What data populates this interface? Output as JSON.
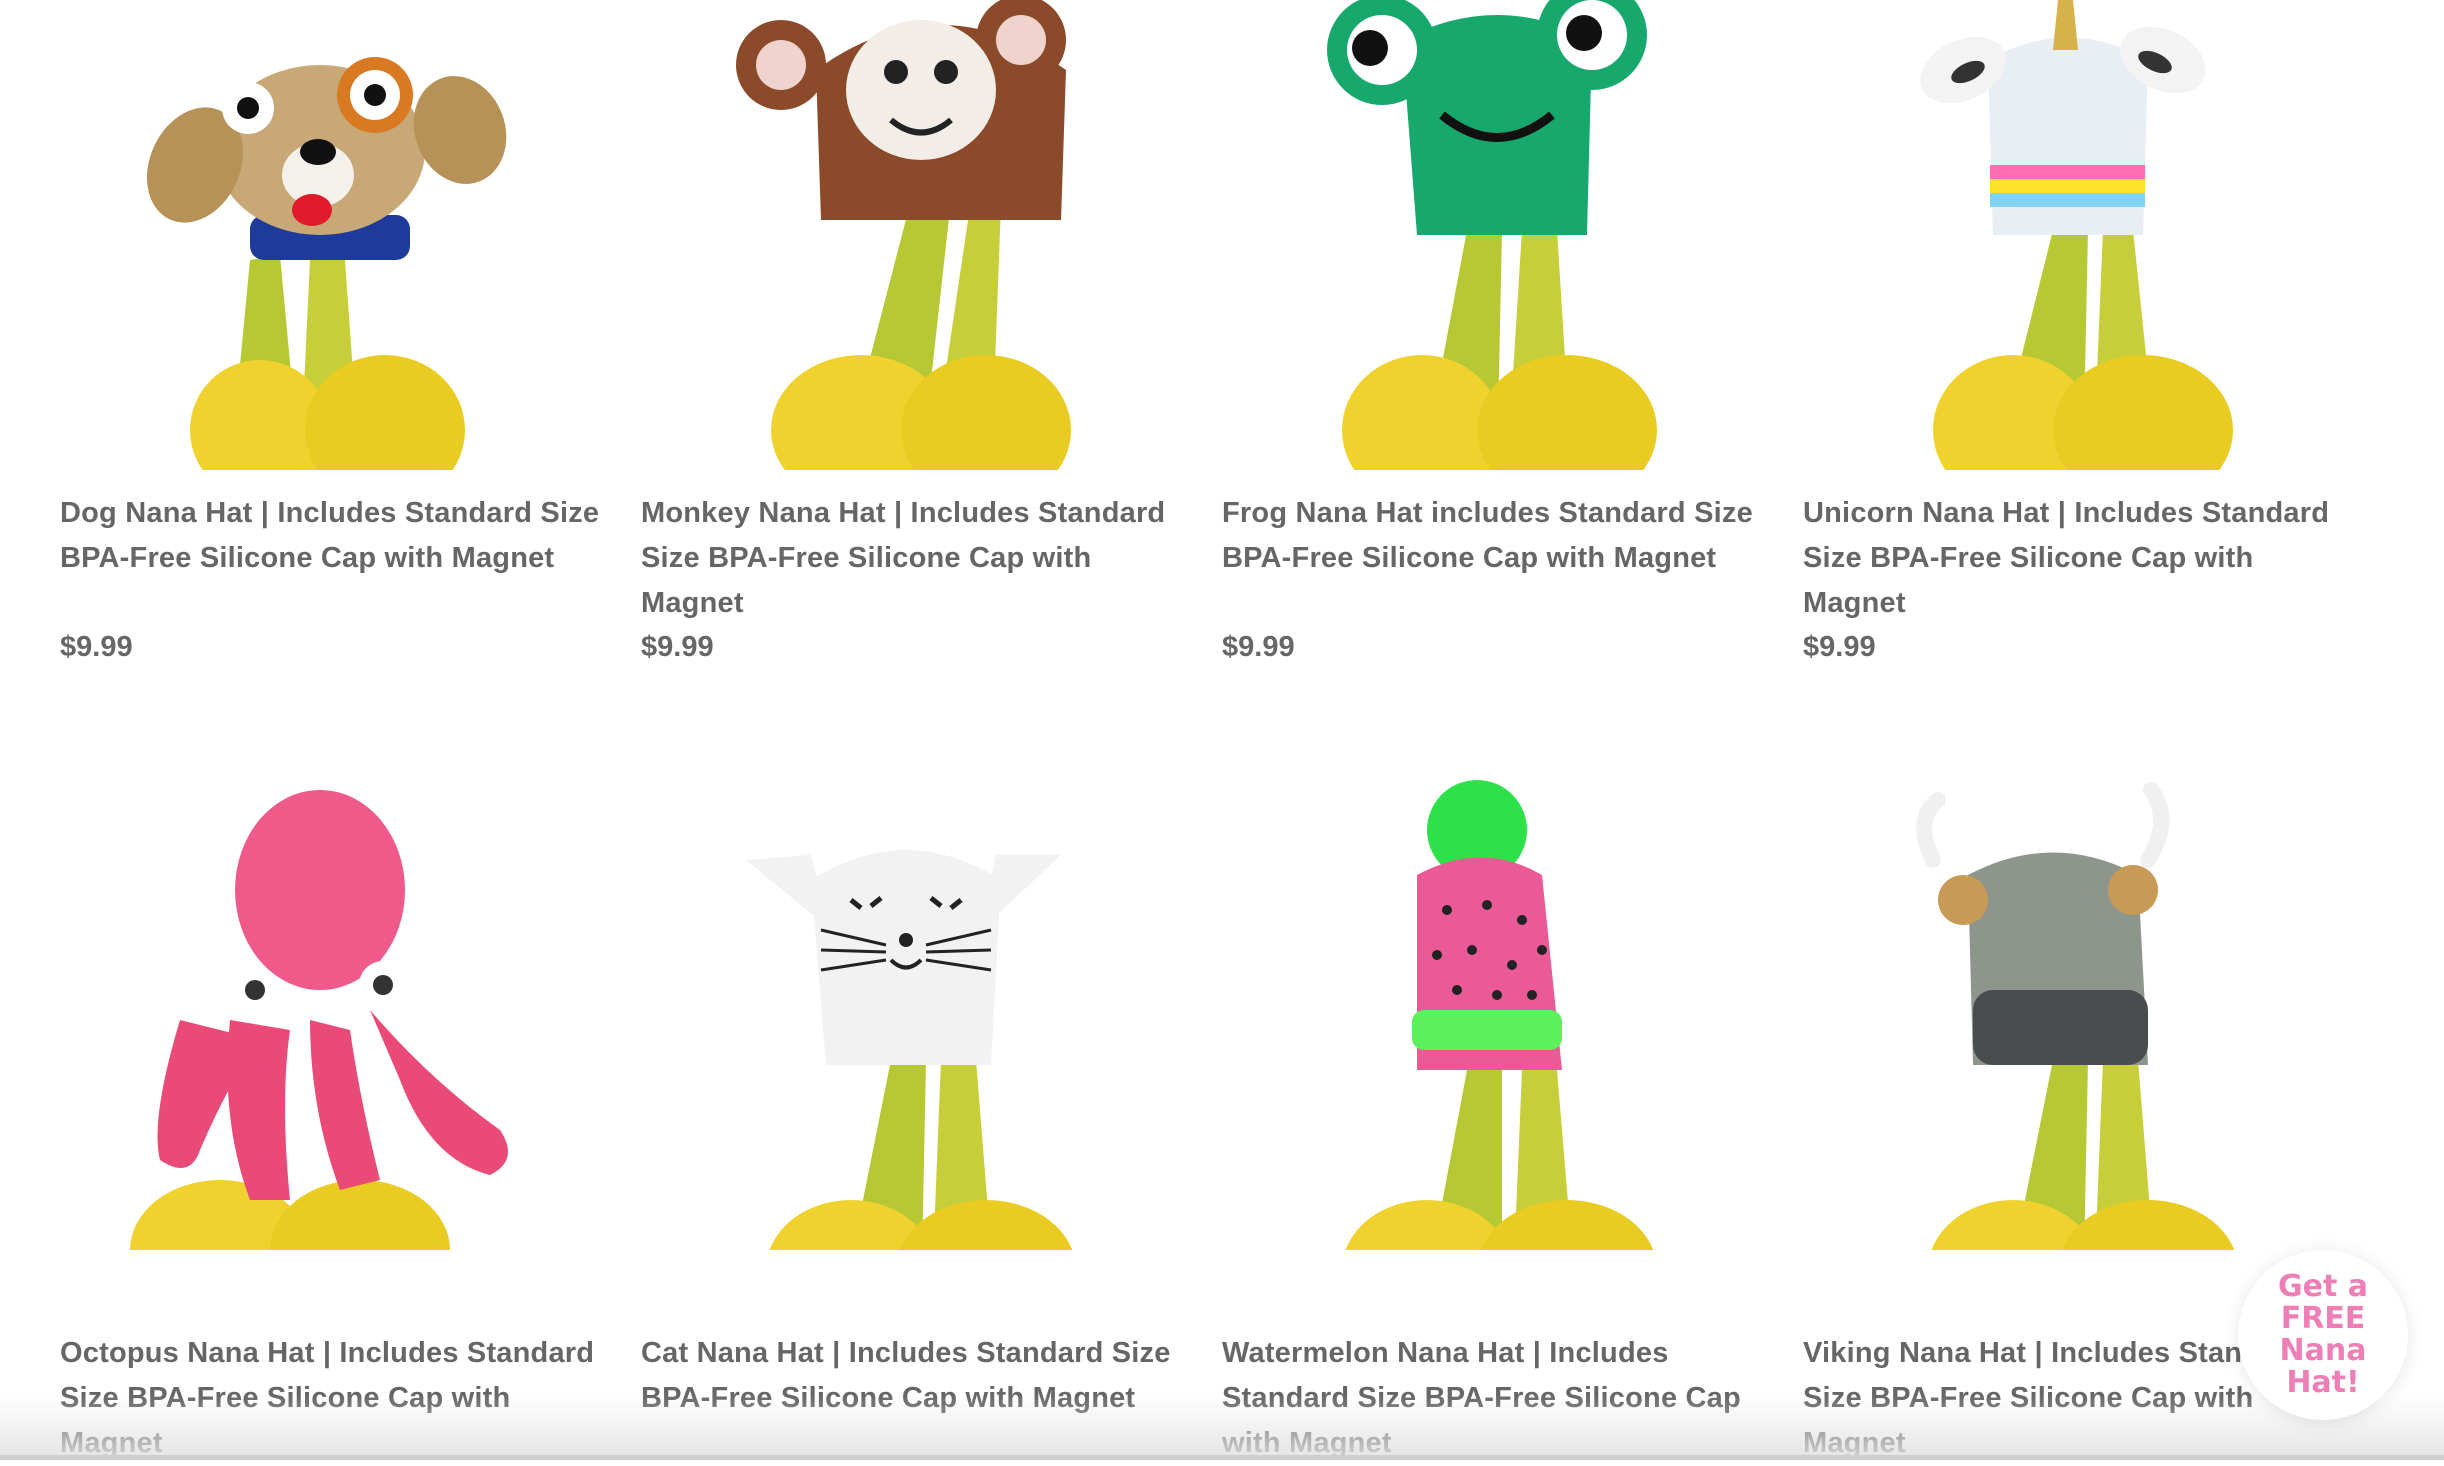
{
  "products": [
    {
      "title": "Dog Nana Hat | Includes Standard Size BPA-Free Silicone Cap with Magnet",
      "price": "$9.99",
      "icon": "dog-hat-icon"
    },
    {
      "title": "Monkey Nana Hat | Includes Standard Size BPA-Free Silicone Cap with Magnet",
      "price": "$9.99",
      "icon": "monkey-hat-icon"
    },
    {
      "title": "Frog Nana Hat includes Standard Size BPA-Free Silicone Cap with Magnet",
      "price": "$9.99",
      "icon": "frog-hat-icon"
    },
    {
      "title": "Unicorn Nana Hat | Includes Standard Size BPA-Free Silicone Cap with Magnet",
      "price": "$9.99",
      "icon": "unicorn-hat-icon"
    },
    {
      "title": "Octopus Nana Hat | Includes Standard Size BPA-Free Silicone Cap with Magnet",
      "price": "",
      "icon": "octopus-hat-icon"
    },
    {
      "title": "Cat Nana Hat | Includes Standard Size BPA-Free Silicone Cap with Magnet",
      "price": "",
      "icon": "cat-hat-icon"
    },
    {
      "title": "Watermelon Nana Hat | Includes Standard Size BPA-Free Silicone Cap with Magnet",
      "price": "",
      "icon": "watermelon-hat-icon"
    },
    {
      "title": "Viking Nana Hat | Includes Standard Size BPA-Free Silicone Cap with Magnet",
      "price": "",
      "icon": "viking-hat-icon"
    }
  ],
  "promo": {
    "label": "Get a FREE Nana Hat!"
  },
  "colors": {
    "text": "#666666",
    "promo": "#ee7fb6",
    "banana": "#f0d22e",
    "stem": "#a9c12a"
  }
}
